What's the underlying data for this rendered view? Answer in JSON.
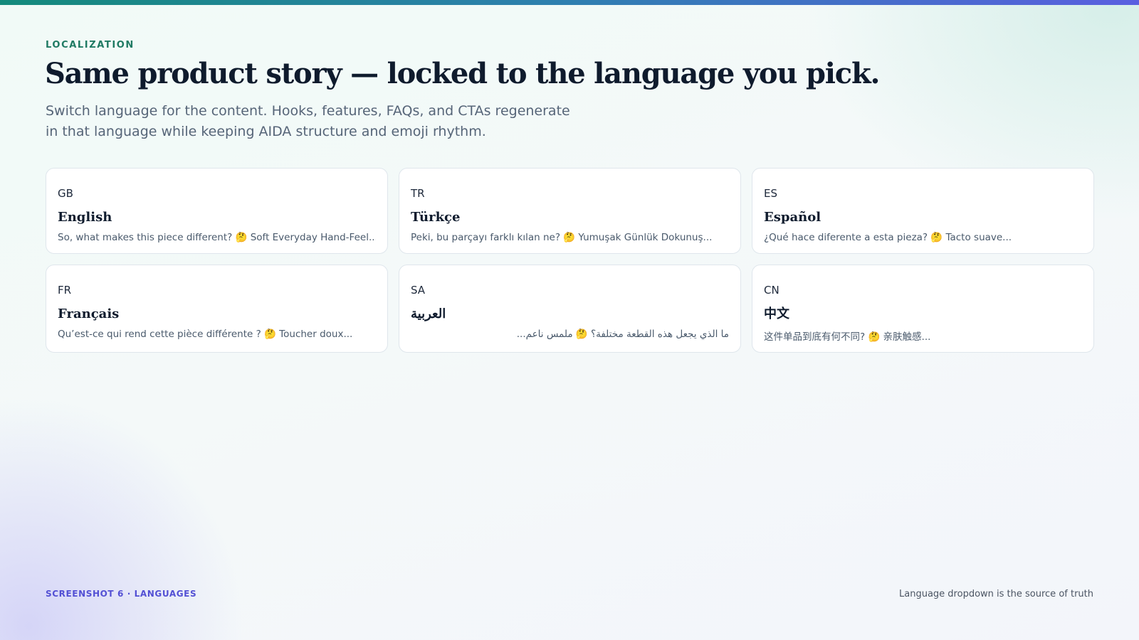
{
  "eyebrow": "LOCALIZATION",
  "headline": "Same product story — locked to the language you pick.",
  "subhead": "Switch language for the content. Hooks, features, FAQs, and CTAs regenerate in that language while keeping AIDA structure and emoji rhythm.",
  "languages": [
    {
      "code": "GB",
      "name": "English",
      "sample": "So, what makes this piece different? 🤔 Soft Everyday Hand-Feel..."
    },
    {
      "code": "TR",
      "name": "Türkçe",
      "sample": "Peki, bu parçayı farklı kılan ne? 🤔 Yumuşak Günlük Dokunuş..."
    },
    {
      "code": "ES",
      "name": "Español",
      "sample": "¿Qué hace diferente a esta pieza? 🤔 Tacto suave..."
    },
    {
      "code": "FR",
      "name": "Français",
      "sample": "Qu’est-ce qui rend cette pièce différente ? 🤔 Toucher doux..."
    },
    {
      "code": "SA",
      "name": "العربية",
      "sample": "ما الذي يجعل هذه القطعة مختلفة؟ 🤔 ملمس ناعم..."
    },
    {
      "code": "CN",
      "name": "中文",
      "sample": "这件单品到底有何不同? 🤔 亲肤触感..."
    }
  ],
  "footer": {
    "left": "SCREENSHOT 6 · LANGUAGES",
    "right": "Language dropdown is the source of truth"
  },
  "colors": {
    "accent_teal": "#1f7a63",
    "accent_indigo": "#5350d4",
    "heading": "#0f1b2d"
  }
}
